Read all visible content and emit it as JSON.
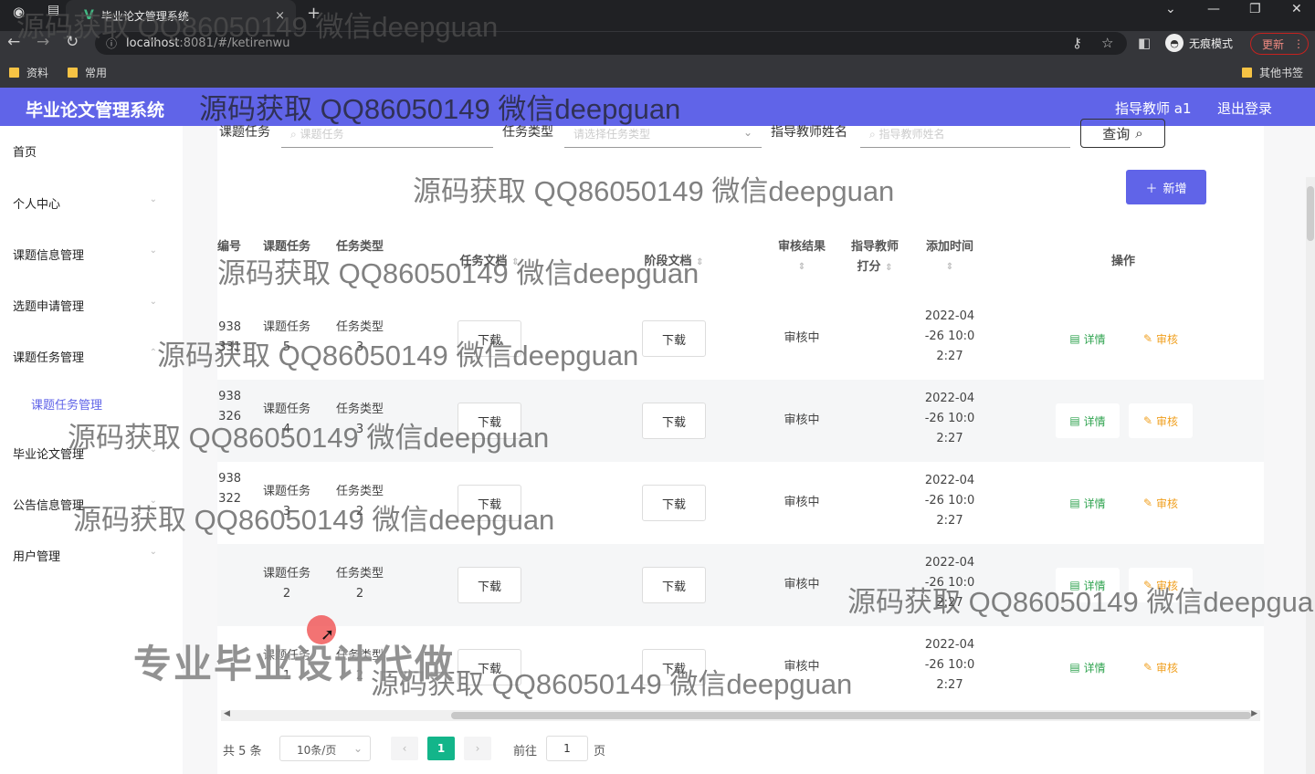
{
  "browser": {
    "tab_title": "毕业论文管理系统",
    "tab_close": "×",
    "new_tab": "+",
    "url_host": "localhost",
    "url_path": ":8081/#/ketirenwu",
    "incognito_label": "无痕模式",
    "update_label": "更新",
    "bookmarks": [
      "资料",
      "常用"
    ],
    "other_bookmarks": "其他书签"
  },
  "app": {
    "title": "毕业论文管理系统",
    "user_label": "指导教师 a1",
    "logout_label": "退出登录"
  },
  "sidebar": {
    "items": [
      "首页",
      "个人中心",
      "课题信息管理",
      "选题申请管理",
      "课题任务管理",
      "毕业论文管理",
      "公告信息管理",
      "用户管理"
    ],
    "active_sub": "课题任务管理"
  },
  "search": {
    "task_label": "课题任务",
    "task_placeholder": "课题任务",
    "type_label": "任务类型",
    "type_placeholder": "请选择任务类型",
    "teacher_label": "指导教师姓名",
    "teacher_placeholder": "指导教师姓名",
    "query_label": "查询",
    "add_label": "新增"
  },
  "table": {
    "headers": {
      "no": "编号",
      "task": "课题任务",
      "type": "任务类型",
      "task_file": "任务文档",
      "stage_file": "阶段文档",
      "audit_result": "审核结果",
      "score_line1": "指导教师",
      "score_line2": "打分",
      "added_time": "添加时间",
      "actions": "操作"
    },
    "rows": [
      {
        "no1": "938",
        "no2": "331",
        "task1": "课题任务",
        "task2": "5",
        "type1": "任务类型",
        "type2": "3",
        "dl1": "下载",
        "dl2": "下载",
        "status": "审核中",
        "t1": "2022-04",
        "t2": "-26 10:0",
        "t3": "2:27",
        "detail": "详情",
        "audit": "审核"
      },
      {
        "no1": "938",
        "no2": "326",
        "task1": "课题任务",
        "task2": "4",
        "type1": "任务类型",
        "type2": "3",
        "dl1": "下载",
        "dl2": "下载",
        "status": "审核中",
        "t1": "2022-04",
        "t2": "-26 10:0",
        "t3": "2:27",
        "detail": "详情",
        "audit": "审核"
      },
      {
        "no1": "938",
        "no2": "322",
        "task1": "课题任务",
        "task2": "3",
        "type1": "任务类型",
        "type2": "2",
        "dl1": "下载",
        "dl2": "下载",
        "status": "审核中",
        "t1": "2022-04",
        "t2": "-26 10:0",
        "t3": "2:27",
        "detail": "详情",
        "audit": "审核"
      },
      {
        "no1": "",
        "no2": "",
        "task1": "课题任务",
        "task2": "2",
        "type1": "任务类型",
        "type2": "2",
        "dl1": "下载",
        "dl2": "下载",
        "status": "审核中",
        "t1": "2022-04",
        "t2": "-26 10:0",
        "t3": "2:27",
        "detail": "详情",
        "audit": "审核"
      },
      {
        "no1": "",
        "no2": "",
        "task1": "课题任务",
        "task2": "1",
        "type1": "任务类型",
        "type2": "2",
        "dl1": "下载",
        "dl2": "下载",
        "status": "审核中",
        "t1": "2022-04",
        "t2": "-26 10:0",
        "t3": "2:27",
        "detail": "详情",
        "audit": "审核"
      }
    ]
  },
  "pagination": {
    "total": "共 5 条",
    "page_size": "10条/页",
    "current": "1",
    "goto_label": "前往",
    "goto_value": "1",
    "page_unit": "页"
  },
  "watermarks": {
    "text": "源码获取 QQ86050149 微信deepguan",
    "text_cut": "源码获取 QQ86050149 微信deepgua",
    "ad": "专业毕业设计代做"
  },
  "colors": {
    "primary": "#6064e8",
    "success": "#2fa34f",
    "warning": "#f0a020",
    "pager_active": "#13b58a"
  }
}
